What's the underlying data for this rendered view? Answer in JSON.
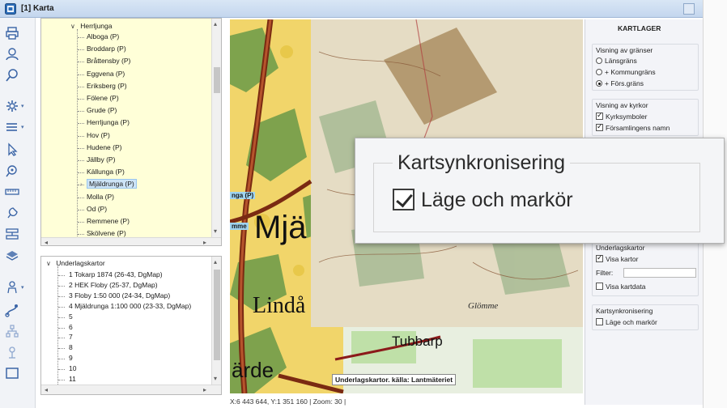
{
  "window": {
    "title": "[1] Karta"
  },
  "toolbar": {
    "tools": [
      "print-icon",
      "locate-person-icon",
      "search-icon",
      "settings-icon",
      "list-menu-icon",
      "pointer-icon",
      "zoom-icon",
      "ruler-icon",
      "pin-icon",
      "layers-toggle-icon",
      "stack-icon",
      "person-menu-icon",
      "route-icon",
      "network-icon",
      "antenna-icon",
      "frame-icon"
    ]
  },
  "parish_tree": {
    "parent": "Herrljunga",
    "items": [
      "Alboga (P)",
      "Broddarp (P)",
      "Bråttensby (P)",
      "Eggvena (P)",
      "Eriksberg (P)",
      "Fölene (P)",
      "Grude (P)",
      "Herrljunga (P)",
      "Hov (P)",
      "Hudene (P)",
      "Jällby (P)",
      "Källunga (P)",
      "Mjäldrunga (P)",
      "Molla (P)",
      "Od (P)",
      "Remmene (P)",
      "Skölvene (P)"
    ],
    "selected": "Mjäldrunga (P)"
  },
  "base_maps_tree": {
    "parent": "Underlagskartor",
    "items": [
      "1 Tokarp 1874 (26-43, DgMap)",
      "2 HEK Floby (25-37, DgMap)",
      "3 Floby 1:50 000 (24-34, DgMap)",
      "4 Mjäldrunga 1:100 000 (23-33, DgMap)",
      "5",
      "6",
      "7",
      "8",
      "9",
      "10",
      "11"
    ]
  },
  "map": {
    "labels": {
      "place_big": "Mjä",
      "place_lindas": "Lindå",
      "place_arde": "ärde",
      "tubbarp": "Tubbarp",
      "glomme": "Glömme",
      "tag_ga": "nga (P)",
      "tag_mme": "mme",
      "attribution": "Underlagskartor. källa: Lantmäteriet"
    }
  },
  "status": {
    "text": "X:6 443 644, Y:1 351 160 | Zoom: 30 |"
  },
  "layers_panel": {
    "title": "KARTLAGER",
    "borders_group": {
      "label": "Visning av gränser",
      "options": [
        "Länsgräns",
        "+ Kommungräns",
        "+ Förs.gräns"
      ],
      "selected": 2
    },
    "churches_group": {
      "label": "Visning av kyrkor",
      "options": [
        "Kyrksymboler",
        "Församlingens namn"
      ]
    },
    "basemaps_group": {
      "label": "Underlagskartor",
      "show_maps": "Visa kartor",
      "filter_label": "Filter:",
      "filter_value": "",
      "show_data": "Visa kartdata"
    },
    "sync_group": {
      "label": "Kartsynkronisering",
      "option": "Läge och markör",
      "checked": false
    }
  },
  "popup": {
    "title": "Kartsynkronisering",
    "option": "Läge och markör",
    "checked": true
  },
  "colors": {
    "map_yellow": "#f1d56a",
    "road_brown": "#7a2a12",
    "selection_blue": "#cde4f7",
    "tree_yellow": "#ffffd8"
  }
}
